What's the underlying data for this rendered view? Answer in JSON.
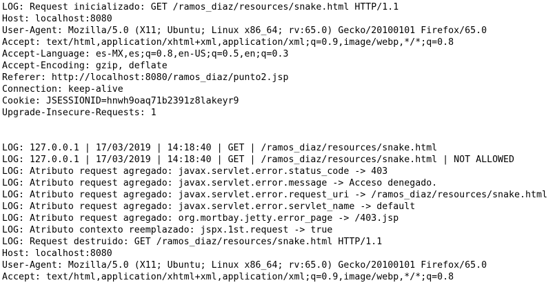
{
  "terminal": {
    "background": "#ffffff",
    "foreground": "#000000",
    "lines": [
      "LOG: Request inicializado: GET /ramos_diaz/resources/snake.html HTTP/1.1",
      "Host: localhost:8080",
      "User-Agent: Mozilla/5.0 (X11; Ubuntu; Linux x86_64; rv:65.0) Gecko/20100101 Firefox/65.0",
      "Accept: text/html,application/xhtml+xml,application/xml;q=0.9,image/webp,*/*;q=0.8",
      "Accept-Language: es-MX,es;q=0.8,en-US;q=0.5,en;q=0.3",
      "Accept-Encoding: gzip, deflate",
      "Referer: http://localhost:8080/ramos_diaz/punto2.jsp",
      "Connection: keep-alive",
      "Cookie: JSESSIONID=hnwh9oaq71b2391z8lakeyr9",
      "Upgrade-Insecure-Requests: 1",
      "",
      "",
      "LOG: 127.0.0.1 | 17/03/2019 | 14:18:40 | GET | /ramos_diaz/resources/snake.html",
      "LOG: 127.0.0.1 | 17/03/2019 | 14:18:40 | GET | /ramos_diaz/resources/snake.html | NOT ALLOWED",
      "LOG: Atributo request agregado: javax.servlet.error.status_code -> 403",
      "LOG: Atributo request agregado: javax.servlet.error.message -> Acceso denegado.",
      "LOG: Atributo request agregado: javax.servlet.error.request_uri -> /ramos_diaz/resources/snake.html",
      "LOG: Atributo request agregado: javax.servlet.error.servlet_name -> default",
      "LOG: Atributo request agregado: org.mortbay.jetty.error_page -> /403.jsp",
      "LOG: Atributo contexto reemplazado: jspx.1st.request -> true",
      "LOG: Request destruido: GET /ramos_diaz/resources/snake.html HTTP/1.1",
      "Host: localhost:8080",
      "User-Agent: Mozilla/5.0 (X11; Ubuntu; Linux x86_64; rv:65.0) Gecko/20100101 Firefox/65.0",
      "Accept: text/html,application/xhtml+xml,application/xml;q=0.9,image/webp,*/*;q=0.8"
    ]
  }
}
